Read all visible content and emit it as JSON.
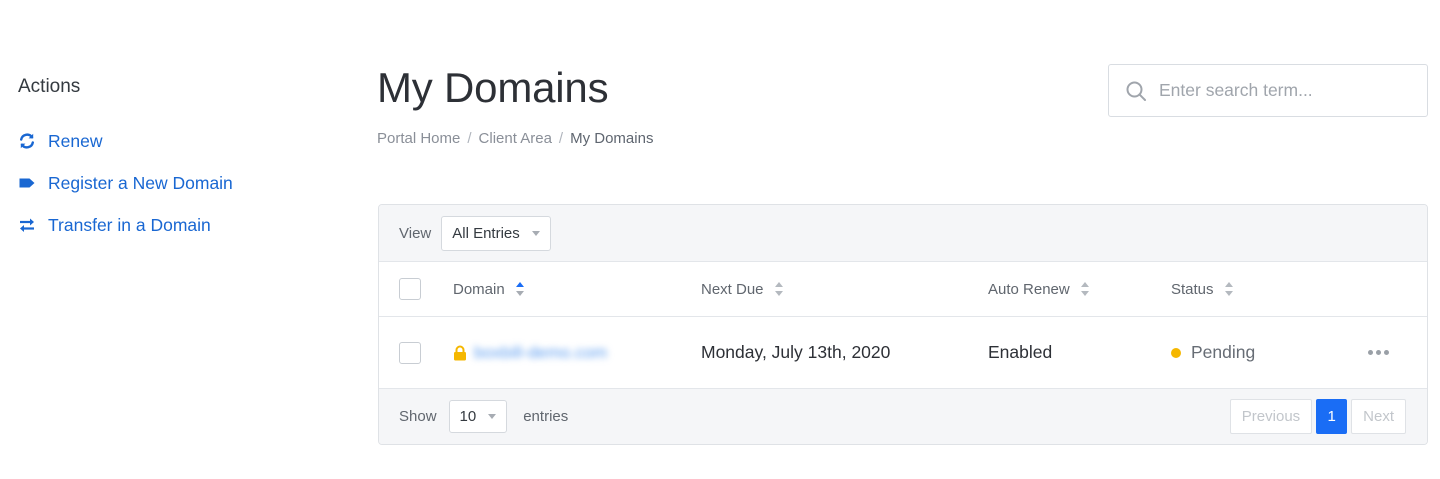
{
  "sidebar": {
    "title": "Actions",
    "items": [
      {
        "label": "Renew",
        "icon": "sync-icon"
      },
      {
        "label": "Register a New Domain",
        "icon": "tag-icon"
      },
      {
        "label": "Transfer in a Domain",
        "icon": "exchange-icon"
      }
    ]
  },
  "header": {
    "title": "My Domains",
    "breadcrumb": [
      "Portal Home",
      "Client Area",
      "My Domains"
    ],
    "search_placeholder": "Enter search term..."
  },
  "table": {
    "view_label": "View",
    "view_selected": "All Entries",
    "columns": [
      "Domain",
      "Next Due",
      "Auto Renew",
      "Status"
    ],
    "rows": [
      {
        "domain": "boxbill-demo.com",
        "next_due": "Monday, July 13th, 2020",
        "auto_renew": "Enabled",
        "status": "Pending"
      }
    ],
    "footer": {
      "show_label": "Show",
      "page_size": "10",
      "entries_label": "entries",
      "prev_label": "Previous",
      "current_page": "1",
      "next_label": "Next"
    }
  },
  "colors": {
    "link": "#1967d2",
    "primary": "#1a6df5",
    "pending": "#f5b700",
    "lock": "#f5b700"
  }
}
